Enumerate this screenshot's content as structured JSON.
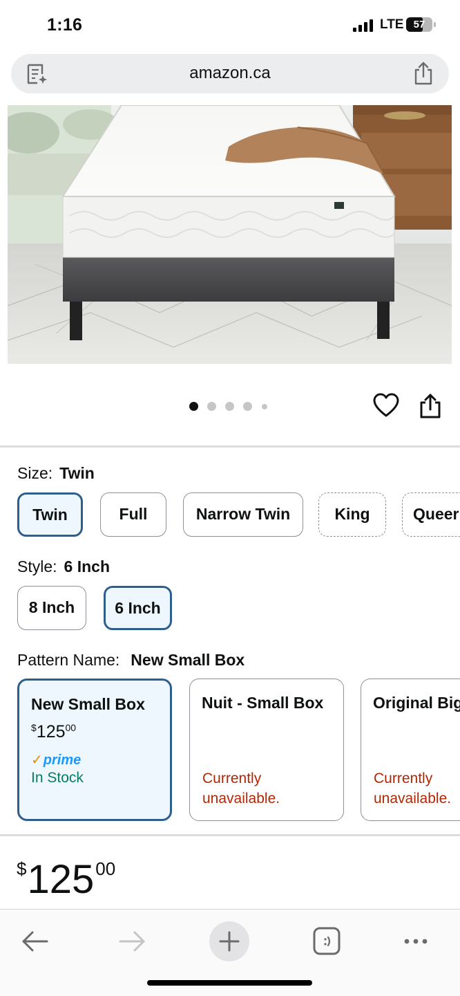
{
  "status_bar": {
    "time": "1:16",
    "network": "LTE",
    "battery": "57"
  },
  "browser": {
    "url": "amazon.ca"
  },
  "carousel": {
    "count": 5,
    "active": 0
  },
  "size": {
    "label": "Size:",
    "selected": "Twin",
    "options": [
      "Twin",
      "Full",
      "Narrow Twin",
      "King",
      "Queer"
    ]
  },
  "style": {
    "label": "Style:",
    "selected": "6 Inch",
    "options": [
      "8 Inch",
      "6 Inch"
    ]
  },
  "pattern": {
    "label": "Pattern Name:",
    "selected": "New Small Box",
    "cards": [
      {
        "title": "New Small Box",
        "price_currency": "$",
        "price_whole": "125",
        "price_cents": "00",
        "prime": "prime",
        "stock": "In Stock"
      },
      {
        "title": "Nuit - Small Box",
        "unavailable_1": "Currently",
        "unavailable_2": "unavailable."
      },
      {
        "title": "Original Big",
        "unavailable_1": "Currently",
        "unavailable_2": "unavailable."
      }
    ]
  },
  "price": {
    "currency": "$",
    "whole": "125",
    "cents": "00"
  },
  "colors": {
    "selected_border": "#2e5e8e",
    "selected_bg": "#eef7fd",
    "in_stock": "#067d62",
    "unavailable": "#b12704",
    "prime": "#1a98ff"
  }
}
